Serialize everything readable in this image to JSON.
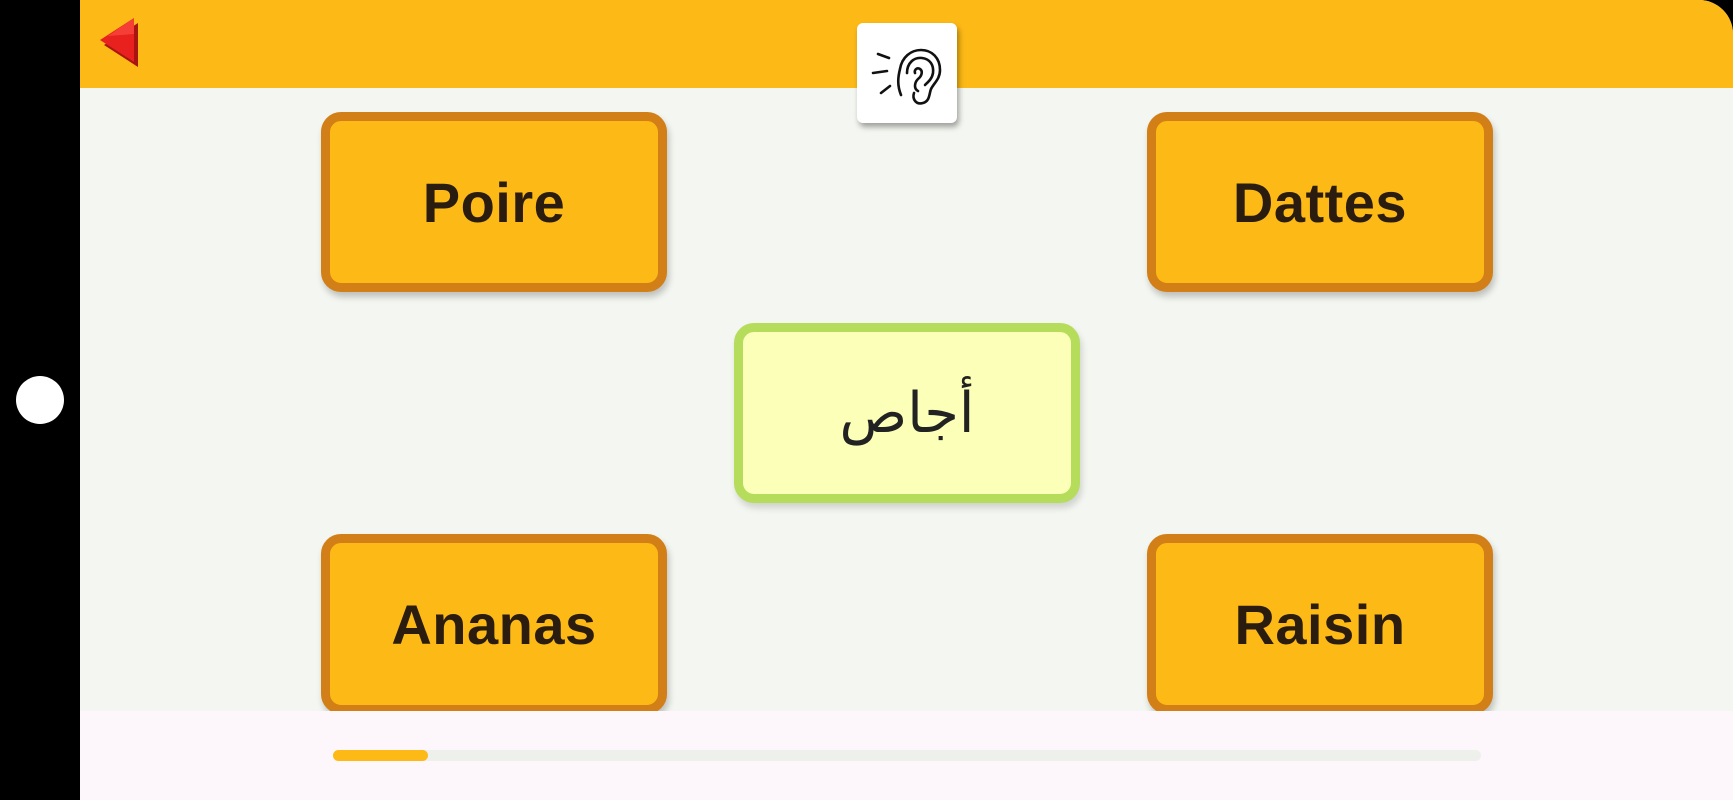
{
  "quiz": {
    "prompt_word": "أجاص",
    "choices": [
      "Poire",
      "Dattes",
      "Ananas",
      "Raisin"
    ],
    "progress": 0.083
  },
  "icons": {
    "back": "back-arrow-icon",
    "listen": "ear-listen-icon",
    "home": "home-dot"
  },
  "colors": {
    "accent": "#fdb915",
    "card_border": "#d17f16",
    "prompt_bg": "#fbffb7",
    "prompt_border": "#b5dc5a",
    "back_arrow": "#e8201e"
  }
}
